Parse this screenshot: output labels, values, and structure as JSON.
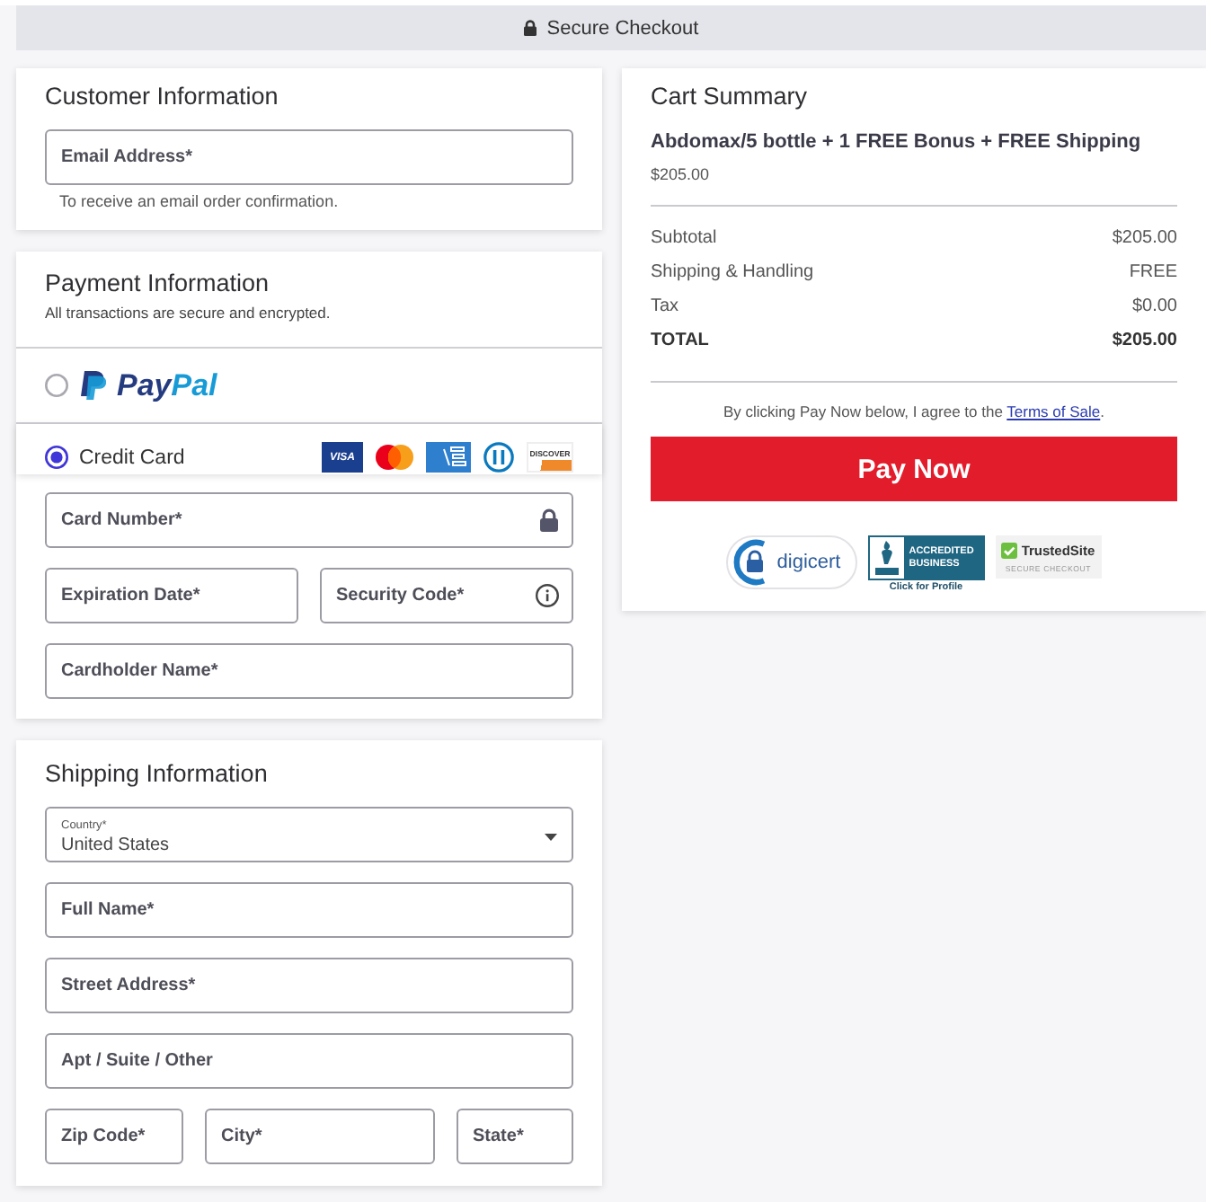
{
  "top_bar": {
    "text": "Secure Checkout"
  },
  "customer": {
    "title": "Customer Information",
    "fields": [
      [
        {
          "kind": "plain",
          "placeholder": "Email Address*"
        }
      ]
    ],
    "hint": "To receive an email order confirmation."
  },
  "payment": {
    "title": "Payment Information",
    "subtitle": "All transactions are secure and encrypted.",
    "methods": [
      {
        "kind": "paypal",
        "label": "PayPal",
        "selected": false
      },
      {
        "kind": "card",
        "label": "Credit Card",
        "selected": true,
        "logos": [
          {
            "kind": "visa",
            "label": "VISA"
          },
          {
            "kind": "mastercard"
          },
          {
            "kind": "amex"
          },
          {
            "kind": "diners"
          },
          {
            "kind": "discover",
            "label": "DISCOVER"
          }
        ]
      }
    ],
    "fields": [
      [
        {
          "kind": "locked",
          "placeholder": "Card Number*"
        }
      ],
      [
        {
          "kind": "plain",
          "placeholder": "Expiration Date*"
        },
        {
          "kind": "help",
          "placeholder": "Security Code*"
        }
      ],
      [
        {
          "kind": "plain",
          "placeholder": "Cardholder Name*"
        }
      ]
    ]
  },
  "shipping": {
    "title": "Shipping Information",
    "country": {
      "label": "Country*",
      "value": "United States"
    },
    "fields": [
      [
        {
          "kind": "plain",
          "placeholder": "Full Name*"
        }
      ],
      [
        {
          "kind": "plain",
          "placeholder": "Street Address*"
        }
      ],
      [
        {
          "kind": "plain",
          "placeholder": "Apt / Suite / Other"
        }
      ],
      [
        {
          "kind": "plain",
          "placeholder": "Zip Code*"
        },
        {
          "kind": "plain",
          "placeholder": "City*"
        },
        {
          "kind": "plain",
          "placeholder": "State*"
        }
      ]
    ]
  },
  "cart": {
    "title": "Cart Summary",
    "product": {
      "name": "Abdomax/5 bottle + 1 FREE Bonus + FREE Shipping",
      "price": "$205.00"
    },
    "lines": [
      {
        "kind": "line",
        "label": "Subtotal",
        "value": "$205.00"
      },
      {
        "kind": "line",
        "label": "Shipping & Handling",
        "value": "FREE"
      },
      {
        "kind": "line",
        "label": "Tax",
        "value": "$0.00"
      },
      {
        "kind": "total",
        "label": "TOTAL",
        "value": "$205.00"
      }
    ],
    "terms": {
      "text": "By clicking Pay Now below, I agree to the",
      "link": "Terms of Sale",
      "after": "."
    },
    "button": "Pay Now",
    "badges": [
      {
        "kind": "digicert",
        "text": "digicert"
      },
      {
        "kind": "bbb",
        "text": "ACCREDITED BUSINESS",
        "caption": "Click for Profile"
      },
      {
        "kind": "trustedsite",
        "text": "TrustedSite",
        "caption": "SECURE CHECKOUT"
      }
    ]
  }
}
